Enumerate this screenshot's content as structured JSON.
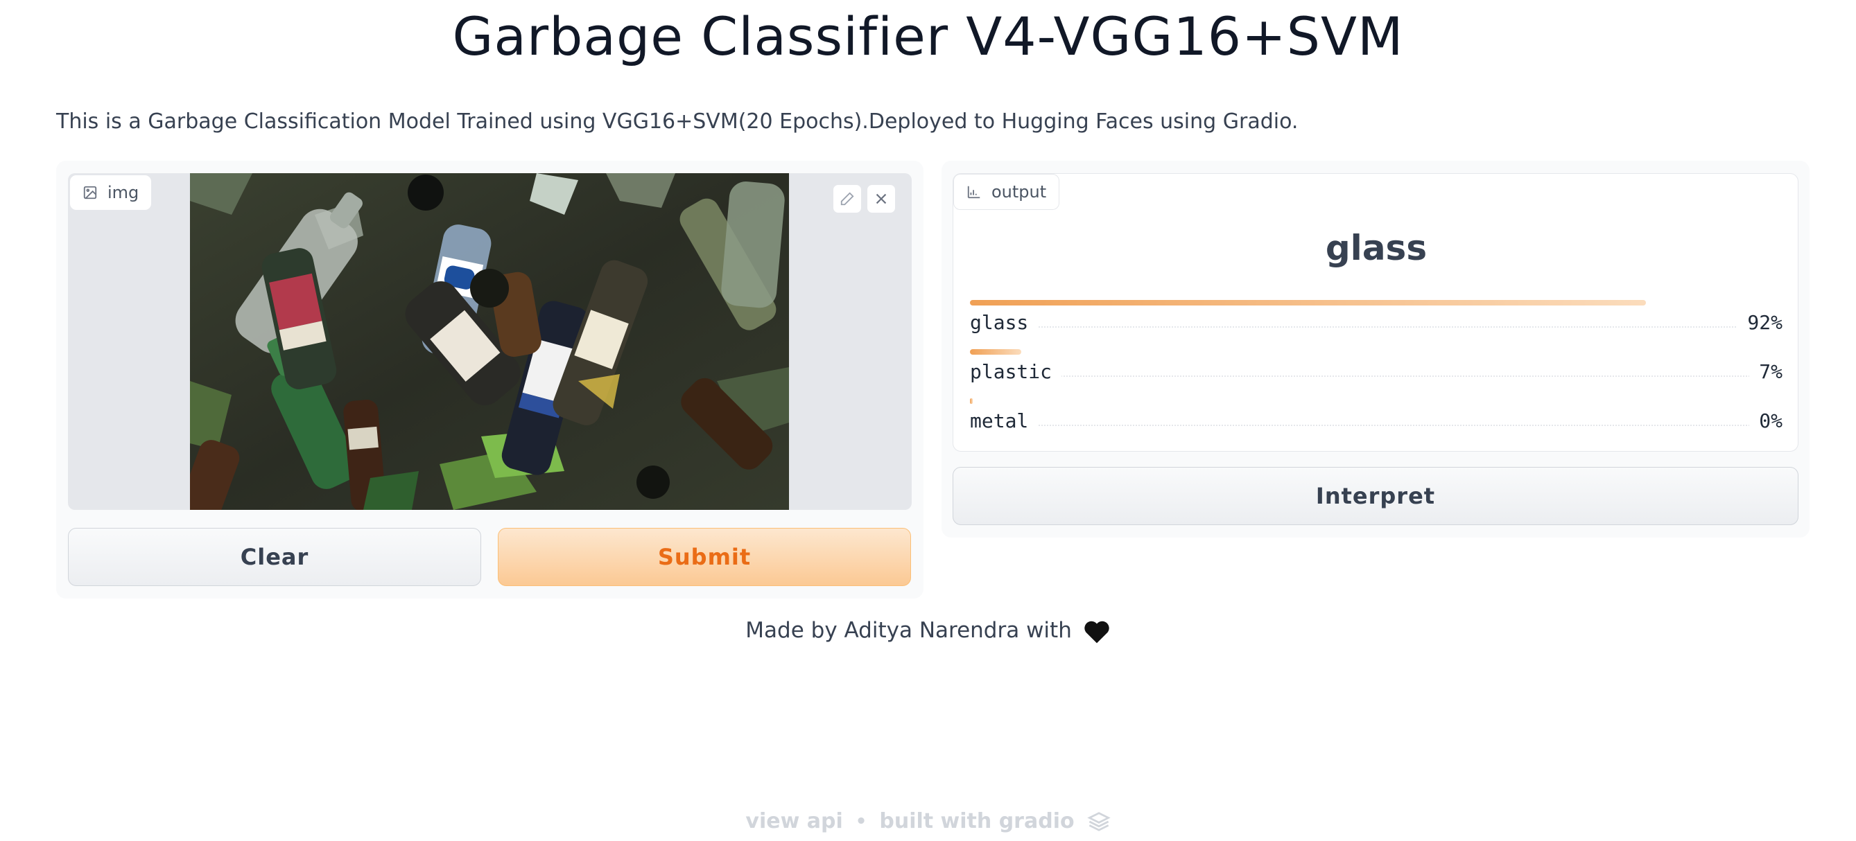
{
  "header": {
    "title": "Garbage Classifier V4-VGG16+SVM",
    "description": "This is a Garbage Classification Model Trained using VGG16+SVM(20 Epochs).Deployed to Hugging Faces using Gradio."
  },
  "input": {
    "label": "img",
    "label_icon": "image-icon",
    "image_alt": "pile of glass bottles",
    "edit_icon": "pencil-icon",
    "close_icon": "close-icon"
  },
  "buttons": {
    "clear": "Clear",
    "submit": "Submit",
    "interpret": "Interpret"
  },
  "output": {
    "label": "output",
    "label_icon": "bar-chart-icon",
    "predicted_label": "glass",
    "confidences": [
      {
        "label": "glass",
        "value": 0.92,
        "display": "92%"
      },
      {
        "label": "plastic",
        "value": 0.07,
        "display": "7%"
      },
      {
        "label": "metal",
        "value": 0.0,
        "display": "0%"
      }
    ]
  },
  "footer": {
    "credit": "Made by Aditya Narendra with",
    "heart_icon": "black-heart-icon",
    "view_api": "view api",
    "separator": "•",
    "built_with": "built with gradio",
    "logo_icon": "gradio-logo-icon"
  },
  "colors": {
    "accent": "#ea6c16",
    "submit_bg": "#fbc994",
    "bar": "#f0a055"
  }
}
